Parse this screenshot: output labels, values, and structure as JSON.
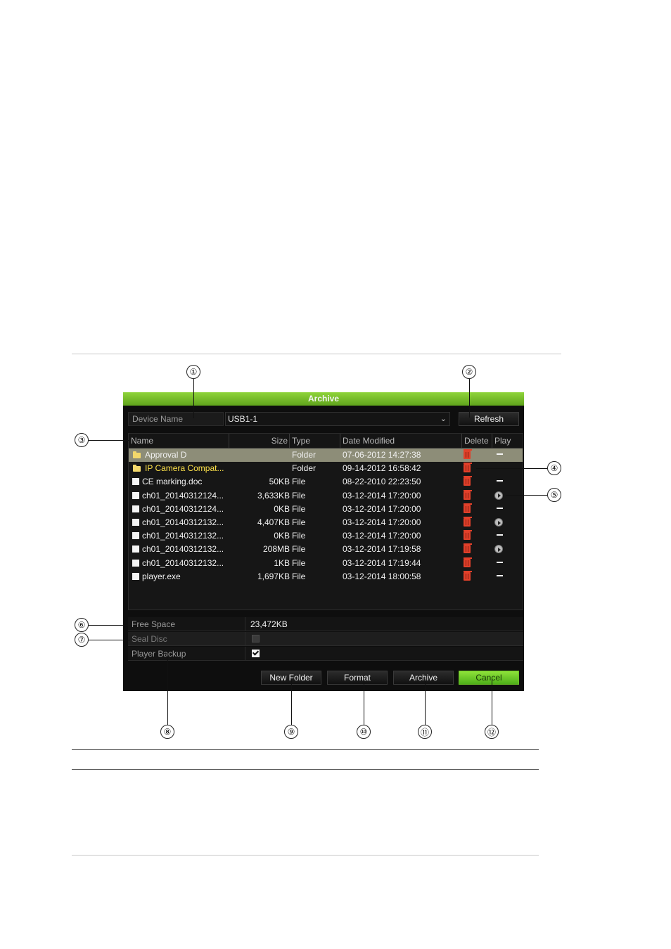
{
  "window": {
    "title": "Archive",
    "device_name_label": "Device Name",
    "device_name_value": "USB1-1",
    "refresh_label": "Refresh"
  },
  "table": {
    "columns": [
      "Name",
      "Size",
      "Type",
      "Date Modified",
      "Delete",
      "Play"
    ],
    "rows": [
      {
        "icon": "folder-icon",
        "name": "Approval D",
        "size": "",
        "type": "Folder",
        "date": "07-06-2012 14:27:38",
        "play": "dash",
        "state": "selected"
      },
      {
        "icon": "folder-icon",
        "name": "IP Camera Compat...",
        "size": "",
        "type": "Folder",
        "date": "09-14-2012 16:58:42",
        "play": "none",
        "state": "highlighted"
      },
      {
        "icon": "file-icon",
        "name": "CE marking.doc",
        "size": "50KB",
        "type": "File",
        "date": "08-22-2010 22:23:50",
        "play": "dash",
        "state": "normal"
      },
      {
        "icon": "file-icon",
        "name": "ch01_20140312124...",
        "size": "3,633KB",
        "type": "File",
        "date": "03-12-2014 17:20:00",
        "play": "play",
        "state": "normal"
      },
      {
        "icon": "file-icon",
        "name": "ch01_20140312124...",
        "size": "0KB",
        "type": "File",
        "date": "03-12-2014 17:20:00",
        "play": "dash",
        "state": "normal"
      },
      {
        "icon": "file-icon",
        "name": "ch01_20140312132...",
        "size": "4,407KB",
        "type": "File",
        "date": "03-12-2014 17:20:00",
        "play": "play",
        "state": "normal"
      },
      {
        "icon": "file-icon",
        "name": "ch01_20140312132...",
        "size": "0KB",
        "type": "File",
        "date": "03-12-2014 17:20:00",
        "play": "dash",
        "state": "normal"
      },
      {
        "icon": "file-icon",
        "name": "ch01_20140312132...",
        "size": "208MB",
        "type": "File",
        "date": "03-12-2014 17:19:58",
        "play": "play",
        "state": "normal"
      },
      {
        "icon": "file-icon",
        "name": "ch01_20140312132...",
        "size": "1KB",
        "type": "File",
        "date": "03-12-2014 17:19:44",
        "play": "dash",
        "state": "normal"
      },
      {
        "icon": "file-icon",
        "name": "player.exe",
        "size": "1,697KB",
        "type": "File",
        "date": "03-12-2014 18:00:58",
        "play": "dash",
        "state": "normal"
      }
    ]
  },
  "info": {
    "free_space_label": "Free Space",
    "free_space_value": "23,472KB",
    "seal_disc_label": "Seal Disc",
    "seal_disc_checked": false,
    "player_backup_label": "Player Backup",
    "player_backup_checked": true
  },
  "buttons": {
    "new_folder": "New Folder",
    "format": "Format",
    "archive": "Archive",
    "cancel": "Cancel"
  },
  "callouts": [
    "①",
    "②",
    "③",
    "④",
    "⑤",
    "⑥",
    "⑦",
    "⑧",
    "⑨",
    "⑩",
    "⑪",
    "⑫"
  ],
  "colors": {
    "accent_green": "#6cc425",
    "delete_red": "#e2402a",
    "highlight_yellow": "#ffe34a",
    "selected_row": "#8d8d78"
  }
}
